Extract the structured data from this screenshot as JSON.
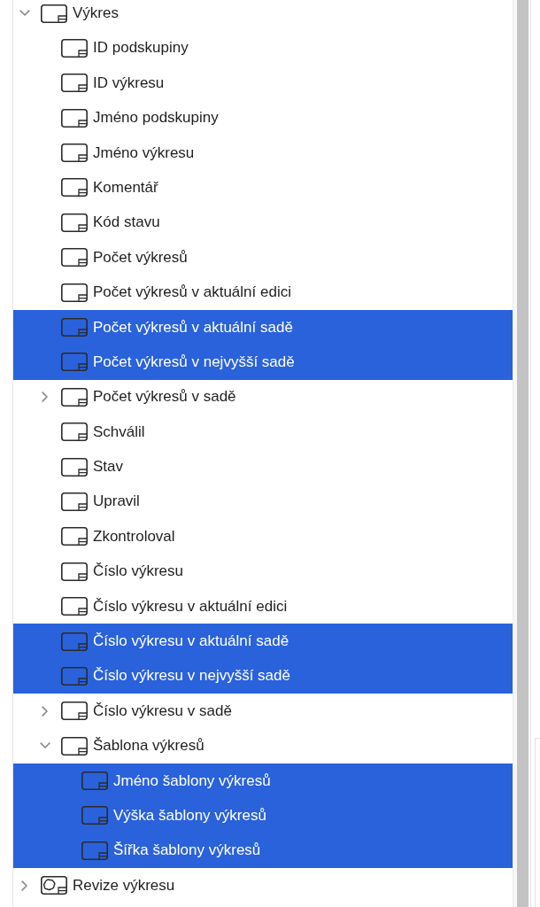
{
  "tree": {
    "items": [
      {
        "kind": "sheet",
        "label": "Výkres",
        "expanded": true,
        "selected": false,
        "children": [
          {
            "kind": "sheet",
            "label": "ID podskupiny",
            "selected": false
          },
          {
            "kind": "sheet",
            "label": "ID výkresu",
            "selected": false
          },
          {
            "kind": "sheet",
            "label": "Jméno podskupiny",
            "selected": false
          },
          {
            "kind": "sheet",
            "label": "Jméno výkresu",
            "selected": false
          },
          {
            "kind": "sheet",
            "label": "Komentář",
            "selected": false
          },
          {
            "kind": "sheet",
            "label": "Kód stavu",
            "selected": false
          },
          {
            "kind": "sheet",
            "label": "Počet výkresů",
            "selected": false
          },
          {
            "kind": "sheet",
            "label": "Počet výkresů v aktuální edici",
            "selected": false
          },
          {
            "kind": "sheet",
            "label": "Počet výkresů v aktuální sadě",
            "selected": true
          },
          {
            "kind": "sheet",
            "label": "Počet výkresů v nejvyšší sadě",
            "selected": true
          },
          {
            "kind": "sheet",
            "label": "Počet výkresů v sadě",
            "expanded": false,
            "selected": false
          },
          {
            "kind": "sheet",
            "label": "Schválil",
            "selected": false
          },
          {
            "kind": "sheet",
            "label": "Stav",
            "selected": false
          },
          {
            "kind": "sheet",
            "label": "Upravil",
            "selected": false
          },
          {
            "kind": "sheet",
            "label": "Zkontroloval",
            "selected": false
          },
          {
            "kind": "sheet",
            "label": "Číslo výkresu",
            "selected": false
          },
          {
            "kind": "sheet",
            "label": "Číslo výkresu v aktuální edici",
            "selected": false
          },
          {
            "kind": "sheet",
            "label": "Číslo výkresu v aktuální sadě",
            "selected": true
          },
          {
            "kind": "sheet",
            "label": "Číslo výkresu v nejvyšší sadě",
            "selected": true
          },
          {
            "kind": "sheet",
            "label": "Číslo výkresu v sadě",
            "expanded": false,
            "selected": false
          },
          {
            "kind": "sheet",
            "label": "Šablona výkresů",
            "expanded": true,
            "selected": false,
            "children": [
              {
                "kind": "sheet",
                "label": "Jméno šablony výkresů",
                "selected": true
              },
              {
                "kind": "sheet",
                "label": "Výška šablony výkresů",
                "selected": true
              },
              {
                "kind": "sheet",
                "label": "Šířka šablony výkresů",
                "selected": true
              }
            ]
          }
        ]
      },
      {
        "kind": "revision",
        "label": "Revize výkresu",
        "expanded": false,
        "selected": false
      }
    ]
  }
}
